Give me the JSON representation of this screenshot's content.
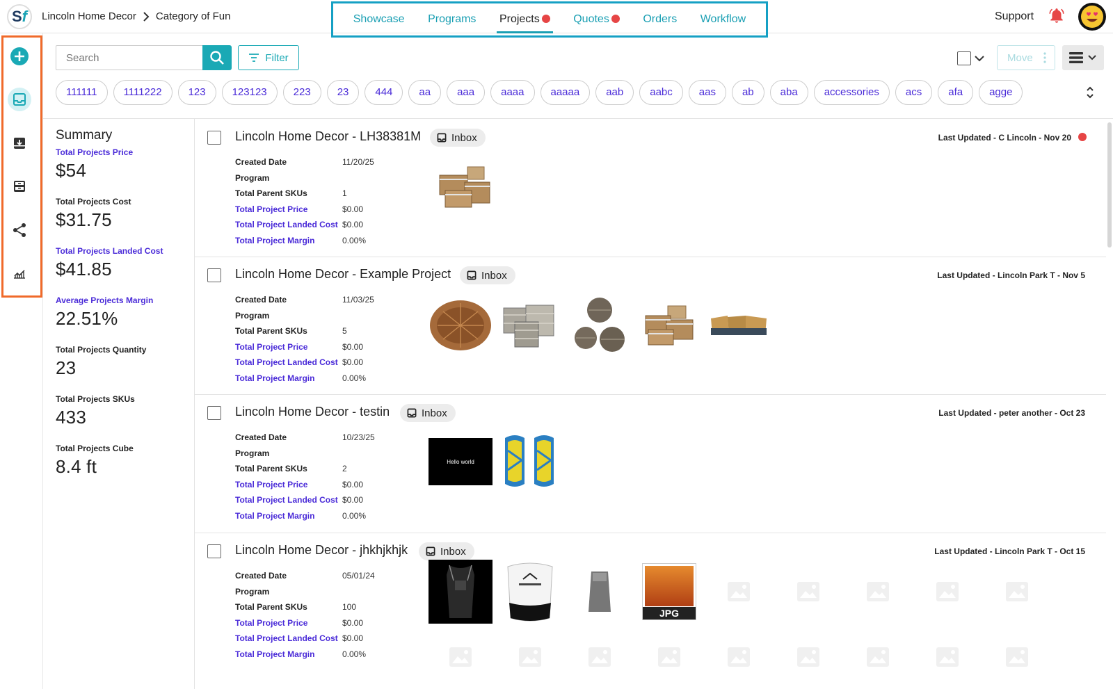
{
  "header": {
    "logo": {
      "s": "S",
      "f": "f"
    },
    "breadcrumb": [
      "Lincoln Home Decor",
      "Category of Fun"
    ],
    "tabs": [
      {
        "label": "Showcase",
        "active": false,
        "dot": false
      },
      {
        "label": "Programs",
        "active": false,
        "dot": false
      },
      {
        "label": "Projects",
        "active": true,
        "dot": true
      },
      {
        "label": "Quotes",
        "active": false,
        "dot": true
      },
      {
        "label": "Orders",
        "active": false,
        "dot": false
      },
      {
        "label": "Workflow",
        "active": false,
        "dot": false
      }
    ],
    "support": "Support"
  },
  "sidebar": {
    "icons": [
      "add-icon",
      "inbox-icon",
      "archive-icon",
      "inbox-stack-icon",
      "share-icon",
      "analytics-icon"
    ],
    "active": "inbox-icon"
  },
  "toolbar": {
    "search_placeholder": "Search",
    "filter_label": "Filter",
    "move_label": "Move"
  },
  "chips": [
    "111111",
    "1111222",
    "123",
    "123123",
    "223",
    "23",
    "444",
    "aa",
    "aaa",
    "aaaa",
    "aaaaa",
    "aab",
    "aabc",
    "aas",
    "ab",
    "aba",
    "accessories",
    "acs",
    "afa",
    "agge"
  ],
  "summary": {
    "title": "Summary",
    "items": [
      {
        "label": "Total Projects Price",
        "value": "$54",
        "accent": true
      },
      {
        "label": "Total Projects Cost",
        "value": "$31.75",
        "accent": false
      },
      {
        "label": "Total Projects Landed Cost",
        "value": "$41.85",
        "accent": true
      },
      {
        "label": "Average Projects Margin",
        "value": "22.51%",
        "accent": true
      },
      {
        "label": "Total Projects Quantity",
        "value": "23",
        "accent": false
      },
      {
        "label": "Total Projects SKUs",
        "value": "433",
        "accent": false
      },
      {
        "label": "Total Projects Cube",
        "value": "8.4 ft",
        "accent": false
      }
    ]
  },
  "field_labels": [
    "Created Date",
    "Program",
    "Total Parent SKUs",
    "Total Project Price",
    "Total Project Landed Cost",
    "Total Project Margin"
  ],
  "inbox_label": "Inbox",
  "projects": [
    {
      "title": "Lincoln Home Decor - LH38381M",
      "updated": "Last Updated - C Lincoln - Nov 20",
      "alert": true,
      "values": [
        "11/20/25",
        "",
        "1",
        "$0.00",
        "$0.00",
        "0.00%"
      ]
    },
    {
      "title": "Lincoln Home Decor - Example Project",
      "updated": "Last Updated - Lincoln Park T - Nov 5",
      "alert": false,
      "values": [
        "11/03/25",
        "",
        "5",
        "$0.00",
        "$0.00",
        "0.00%"
      ]
    },
    {
      "title": "Lincoln Home Decor - testin",
      "updated": "Last Updated - peter another - Oct 23",
      "alert": false,
      "values": [
        "10/23/25",
        "",
        "2",
        "$0.00",
        "$0.00",
        "0.00%"
      ]
    },
    {
      "title": "Lincoln Home Decor - jhkhjkhjk",
      "updated": "Last Updated - Lincoln Park T - Oct 15",
      "alert": false,
      "values": [
        "05/01/24",
        "",
        "100",
        "$0.00",
        "$0.00",
        "0.00%"
      ]
    }
  ],
  "thumb_texts": {
    "hello": "Hello world",
    "jpg": "JPG"
  },
  "colors": {
    "accent": "#1aa9b5",
    "purple": "#4a2bd8",
    "alert": "#e64545",
    "highlight_nav": "#15a0c4",
    "highlight_rail": "#f06a2a"
  }
}
